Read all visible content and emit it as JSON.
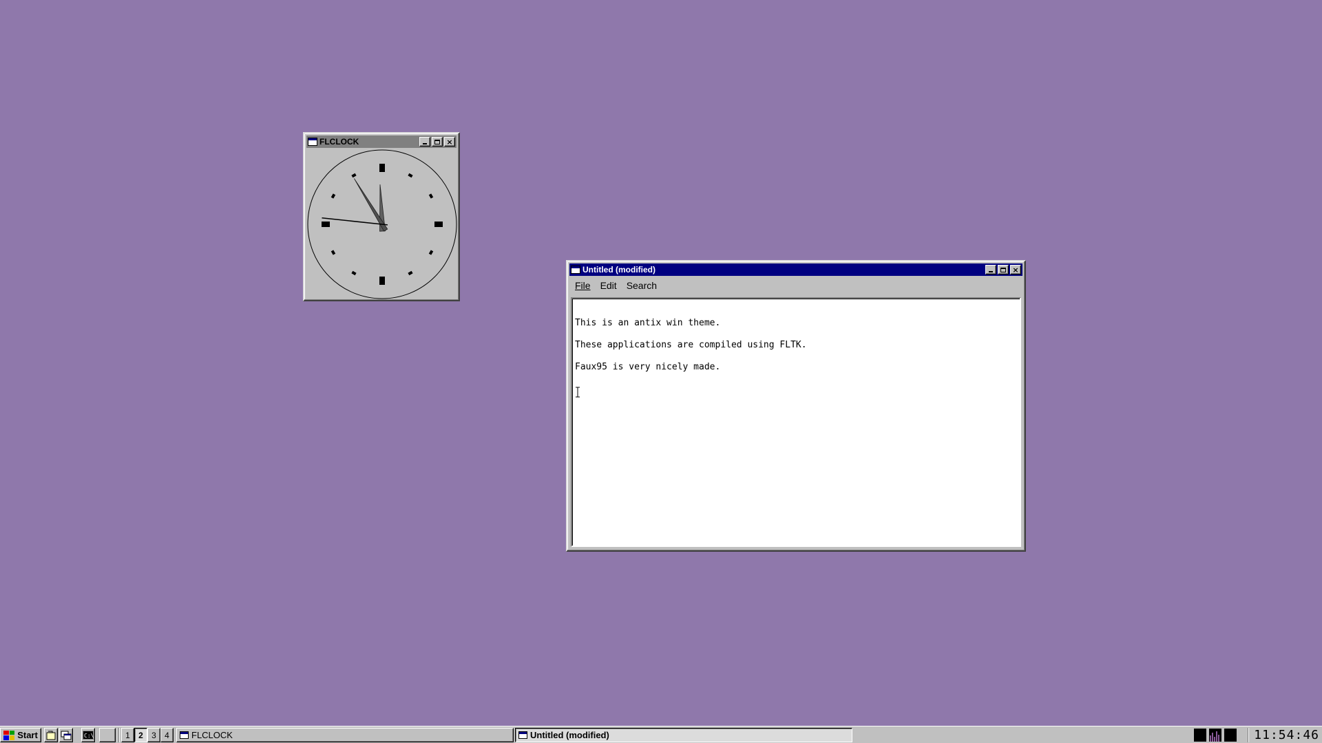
{
  "desktop": {
    "background_color": "#8f78ab"
  },
  "clock_window": {
    "title": "FLCLOCK",
    "time": {
      "hour": 11,
      "minute": 54,
      "second": 46
    }
  },
  "editor_window": {
    "title": "Untitled (modified)",
    "menu": [
      {
        "label": "File"
      },
      {
        "label": "Edit"
      },
      {
        "label": "Search"
      }
    ],
    "lines": [
      "This is an antix win theme.",
      "These applications are compiled using FLTK.",
      "Faux95 is very nicely made."
    ]
  },
  "taskbar": {
    "start_label": "Start",
    "quick_launch": [
      "file-manager-icon",
      "windows-icon",
      "terminal-icon"
    ],
    "desktops": [
      "1",
      "2",
      "3",
      "4"
    ],
    "active_desktop": "2",
    "tasks": [
      {
        "label": "FLCLOCK",
        "active": false
      },
      {
        "label": "Untitled (modified)",
        "active": true
      }
    ],
    "clock": "11:54:46"
  }
}
